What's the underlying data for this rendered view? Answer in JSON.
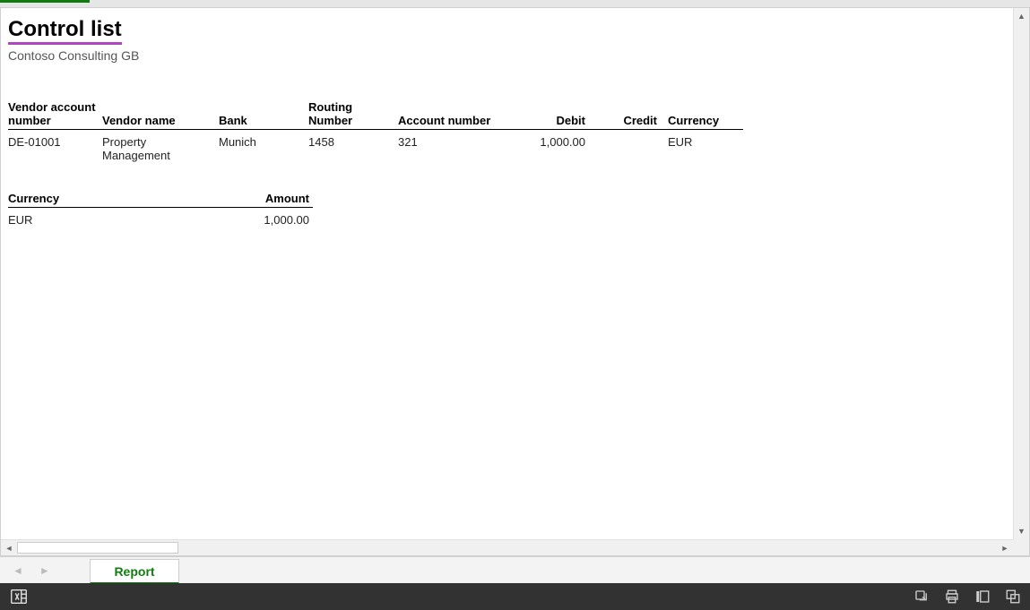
{
  "header": {
    "title": "Control list",
    "company": "Contoso Consulting GB"
  },
  "main_table": {
    "headers": {
      "vendor_account": "Vendor account number",
      "vendor_name": "Vendor name",
      "bank": "Bank",
      "routing": "Routing Number",
      "account": "Account number",
      "debit": "Debit",
      "credit": "Credit",
      "currency": "Currency"
    },
    "rows": [
      {
        "vendor_account": "DE-01001",
        "vendor_name": "Property Management",
        "bank": "Munich",
        "routing": "1458",
        "account": "321",
        "debit": "1,000.00",
        "credit": "",
        "currency": "EUR"
      }
    ]
  },
  "summary_table": {
    "headers": {
      "currency": "Currency",
      "amount": "Amount"
    },
    "rows": [
      {
        "currency": "EUR",
        "amount": "1,000.00"
      }
    ]
  },
  "tabs": {
    "report": "Report"
  }
}
